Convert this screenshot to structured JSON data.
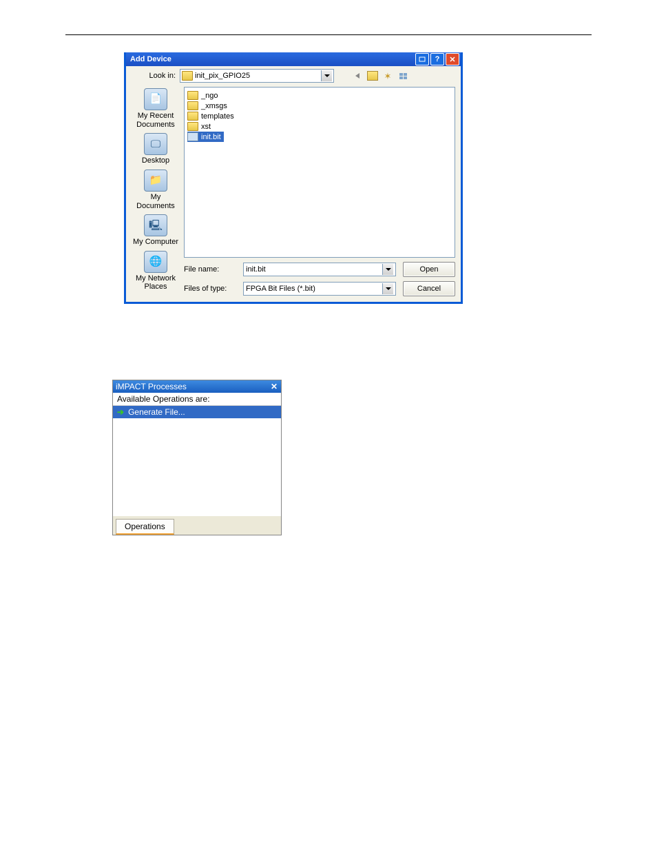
{
  "dialog": {
    "title": "Add Device",
    "lookin_label": "Look in:",
    "lookin_value": "init_pix_GPIO25",
    "places": [
      {
        "label": "My Recent Documents",
        "cls": "doc"
      },
      {
        "label": "Desktop",
        "cls": "desk"
      },
      {
        "label": "My Documents",
        "cls": "docs"
      },
      {
        "label": "My Computer",
        "cls": "comp"
      },
      {
        "label": "My Network Places",
        "cls": "net"
      }
    ],
    "files": [
      {
        "name": "_ngo",
        "selected": false
      },
      {
        "name": "_xmsgs",
        "selected": false
      },
      {
        "name": "templates",
        "selected": false
      },
      {
        "name": "xst",
        "selected": false
      },
      {
        "name": "init.bit",
        "selected": true
      }
    ],
    "filename_label": "File name:",
    "filename_value": "init.bit",
    "filetype_label": "Files of type:",
    "filetype_value": "FPGA Bit Files (*.bit)",
    "open_btn": "Open",
    "cancel_btn": "Cancel"
  },
  "pane": {
    "title": "iMPACT Processes",
    "header": "Available Operations are:",
    "item": "Generate File...",
    "tab": "Operations"
  }
}
